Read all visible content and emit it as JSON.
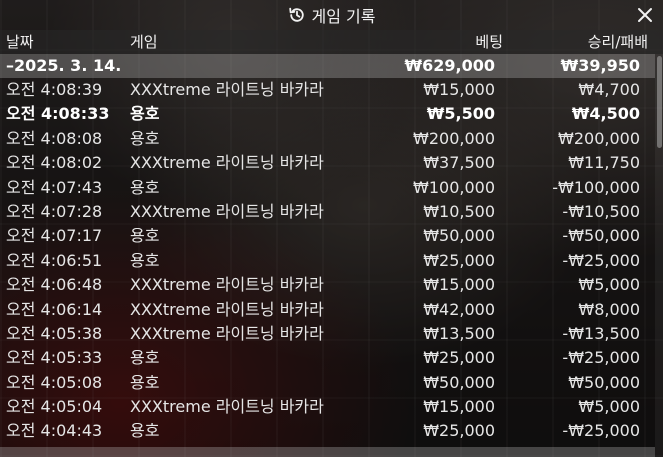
{
  "title": "게임 기록",
  "columns": {
    "date": "날짜",
    "game": "게임",
    "bet": "베팅",
    "result": "승리/패배"
  },
  "summary": {
    "date": "–2025. 3. 14.",
    "bet": "₩629,000",
    "result": "₩39,950"
  },
  "rows": [
    {
      "time": "오전 4:08:39",
      "game": "XXXtreme 라이트닝 바카라",
      "bet": "₩15,000",
      "result": "₩4,700",
      "highlight": false
    },
    {
      "time": "오전 4:08:33",
      "game": "용호",
      "bet": "₩5,500",
      "result": "₩4,500",
      "highlight": true
    },
    {
      "time": "오전 4:08:08",
      "game": "용호",
      "bet": "₩200,000",
      "result": "₩200,000",
      "highlight": false
    },
    {
      "time": "오전 4:08:02",
      "game": "XXXtreme 라이트닝 바카라",
      "bet": "₩37,500",
      "result": "₩11,750",
      "highlight": false
    },
    {
      "time": "오전 4:07:43",
      "game": "용호",
      "bet": "₩100,000",
      "result": "-₩100,000",
      "highlight": false
    },
    {
      "time": "오전 4:07:28",
      "game": "XXXtreme 라이트닝 바카라",
      "bet": "₩10,500",
      "result": "-₩10,500",
      "highlight": false
    },
    {
      "time": "오전 4:07:17",
      "game": "용호",
      "bet": "₩50,000",
      "result": "-₩50,000",
      "highlight": false
    },
    {
      "time": "오전 4:06:51",
      "game": "용호",
      "bet": "₩25,000",
      "result": "-₩25,000",
      "highlight": false
    },
    {
      "time": "오전 4:06:48",
      "game": "XXXtreme 라이트닝 바카라",
      "bet": "₩15,000",
      "result": "₩5,000",
      "highlight": false
    },
    {
      "time": "오전 4:06:14",
      "game": "XXXtreme 라이트닝 바카라",
      "bet": "₩42,000",
      "result": "₩8,000",
      "highlight": false
    },
    {
      "time": "오전 4:05:38",
      "game": "XXXtreme 라이트닝 바카라",
      "bet": "₩13,500",
      "result": "-₩13,500",
      "highlight": false
    },
    {
      "time": "오전 4:05:33",
      "game": "용호",
      "bet": "₩25,000",
      "result": "-₩25,000",
      "highlight": false
    },
    {
      "time": "오전 4:05:08",
      "game": "용호",
      "bet": "₩50,000",
      "result": "₩50,000",
      "highlight": false
    },
    {
      "time": "오전 4:05:04",
      "game": "XXXtreme 라이트닝 바카라",
      "bet": "₩15,000",
      "result": "₩5,000",
      "highlight": false
    },
    {
      "time": "오전 4:04:43",
      "game": "용호",
      "bet": "₩25,000",
      "result": "-₩25,000",
      "highlight": false
    }
  ]
}
